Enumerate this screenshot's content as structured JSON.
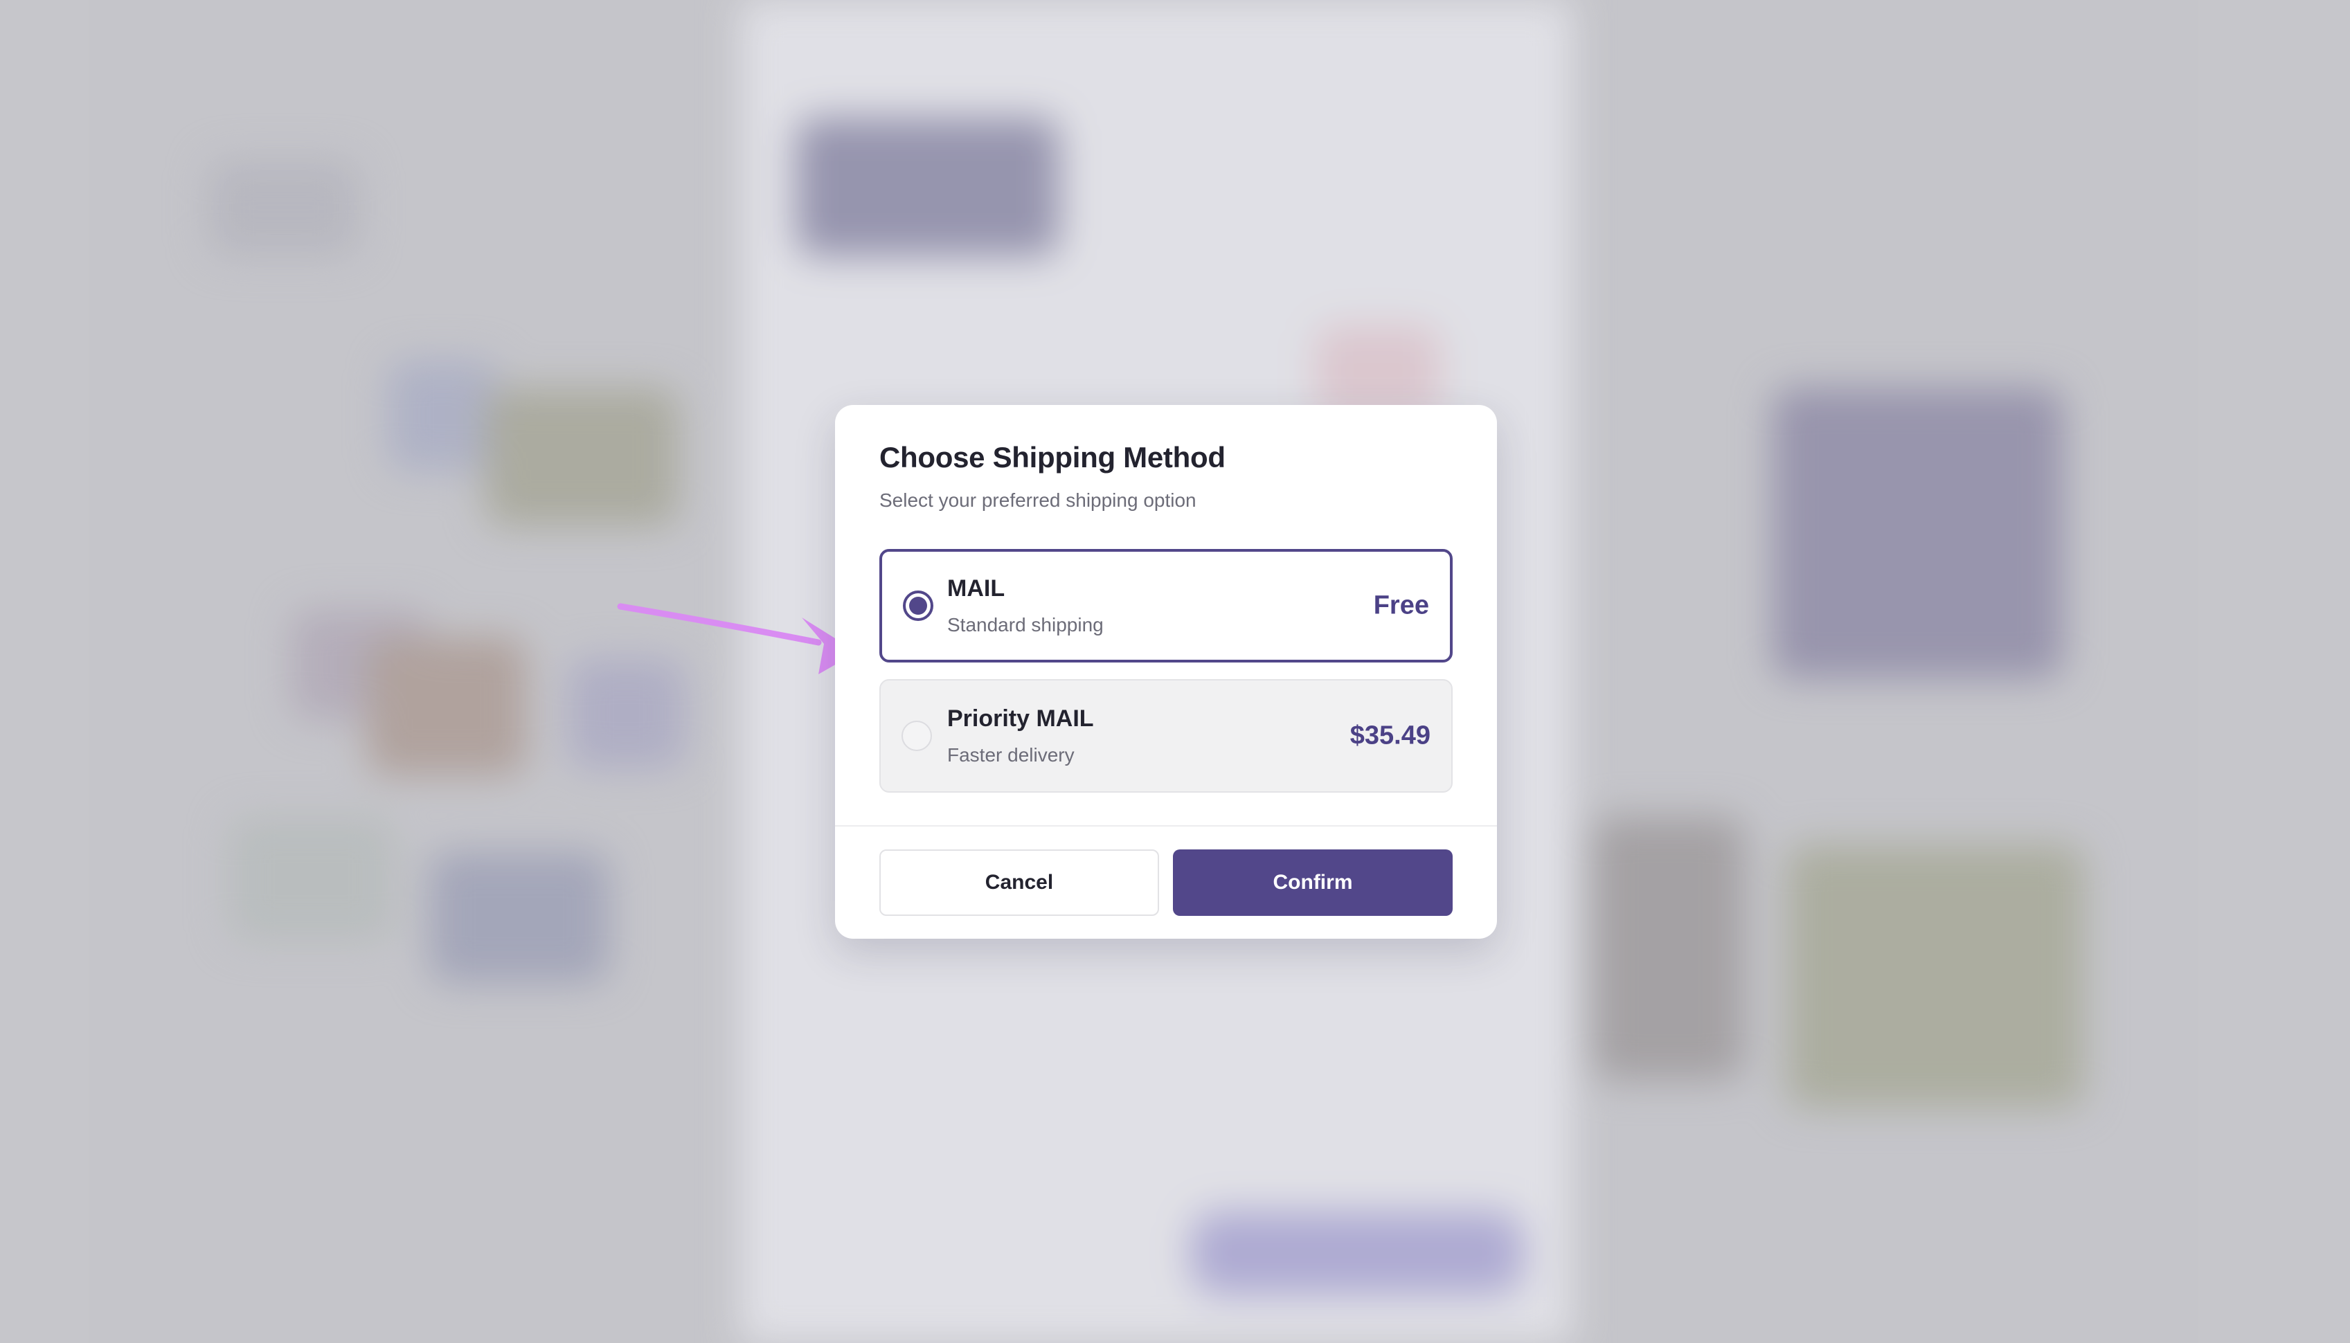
{
  "modal": {
    "title": "Choose Shipping Method",
    "subtitle": "Select your preferred shipping option",
    "options": [
      {
        "name": "MAIL",
        "description": "Standard shipping",
        "price": "Free",
        "selected": true
      },
      {
        "name": "Priority MAIL",
        "description": "Faster delivery",
        "price": "$35.49",
        "selected": false
      }
    ],
    "cancel_label": "Cancel",
    "confirm_label": "Confirm"
  },
  "colors": {
    "accent": "#52478a",
    "annotation_arrow": "#d98cf2",
    "backdrop": "#c5c5ca"
  },
  "icons": {
    "selected_radio": "radio-selected-icon",
    "unselected_radio": "radio-unselected-icon",
    "annotation": "annotation-arrow-icon"
  }
}
